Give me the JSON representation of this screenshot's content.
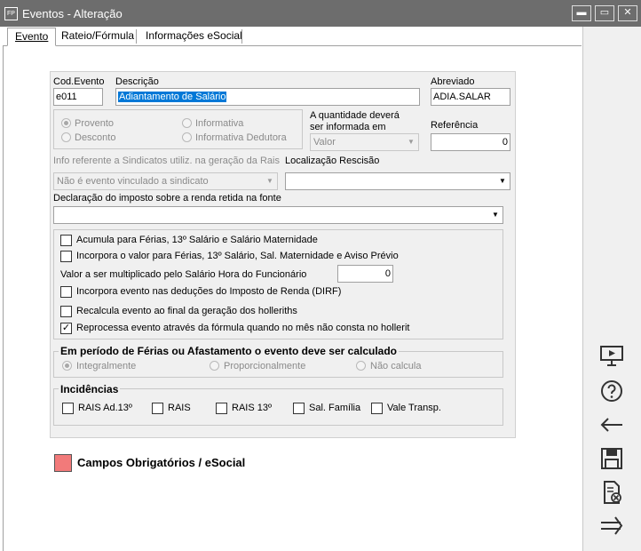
{
  "window": {
    "icon_text": "FP",
    "title": "Eventos - Alteração",
    "min_glyph": "▬",
    "max_glyph": "▭",
    "close_glyph": "✕"
  },
  "tabs": [
    {
      "label": "Evento"
    },
    {
      "label": "Rateio/Fórmula"
    },
    {
      "label": "Informações eSocial"
    }
  ],
  "form": {
    "cod_evento_label": "Cod.Evento",
    "cod_evento_value": "e011",
    "descricao_label": "Descrição",
    "descricao_value": "Adiantamento de Salário",
    "abreviado_label": "Abreviado",
    "abreviado_value": "ADIA.SALAR",
    "tipo": {
      "provento": "Provento",
      "desconto": "Desconto",
      "informativa": "Informativa",
      "informativa_dedutora": "Informativa Dedutora"
    },
    "quantidade_label_1": "A quantidade deverá",
    "quantidade_label_2": "ser informada em",
    "quantidade_value": "Valor",
    "referencia_label": "Referência",
    "referencia_value": "0",
    "sindicato_label": "Info referente a Sindicatos utiliz. na geração da Rais",
    "sindicato_value": "Não é evento vinculado a sindicato",
    "rescisao_label": "Localização Rescisão",
    "rescisao_value": "",
    "declaracao_label": "Declaração do imposto sobre a renda retida na fonte",
    "declaracao_value": "",
    "checks": {
      "acumula": "Acumula para Férias, 13º Salário e Salário Maternidade",
      "incorpora_valor": "Incorpora o valor para Férias, 13º Salário, Sal. Maternidade e Aviso Prévio",
      "multiplicado_label": "Valor a ser multiplicado pelo Salário Hora do Funcionário",
      "multiplicado_value": "0",
      "dirf": "Incorpora evento nas deduções do Imposto de Renda (DIRF)",
      "recalcula": "Recalcula evento ao final da geração dos holleriths",
      "reprocessa": "Reprocessa evento através da fórmula quando no mês não consta no hollerit",
      "check_glyph": "✓"
    },
    "ferias_group": {
      "title": "Em período de Férias ou Afastamento o evento deve ser calculado",
      "integralmente": "Integralmente",
      "proporcionalmente": "Proporcionalmente",
      "nao_calcula": "Não calcula"
    },
    "incidencias_group": {
      "title": "Incidências",
      "rais_ad13": "RAIS Ad.13º",
      "rais": "RAIS",
      "rais13": "RAIS 13º",
      "sal_familia": "Sal. Família",
      "vale_transp": "Vale Transp."
    }
  },
  "legend": {
    "text": "Campos Obrigatórios / eSocial",
    "color": "#f27a7a"
  },
  "sidebar_icons": [
    "presentation-icon",
    "help-icon",
    "back-arrow-icon",
    "save-icon",
    "delete-document-icon",
    "forward-arrow-icon"
  ]
}
